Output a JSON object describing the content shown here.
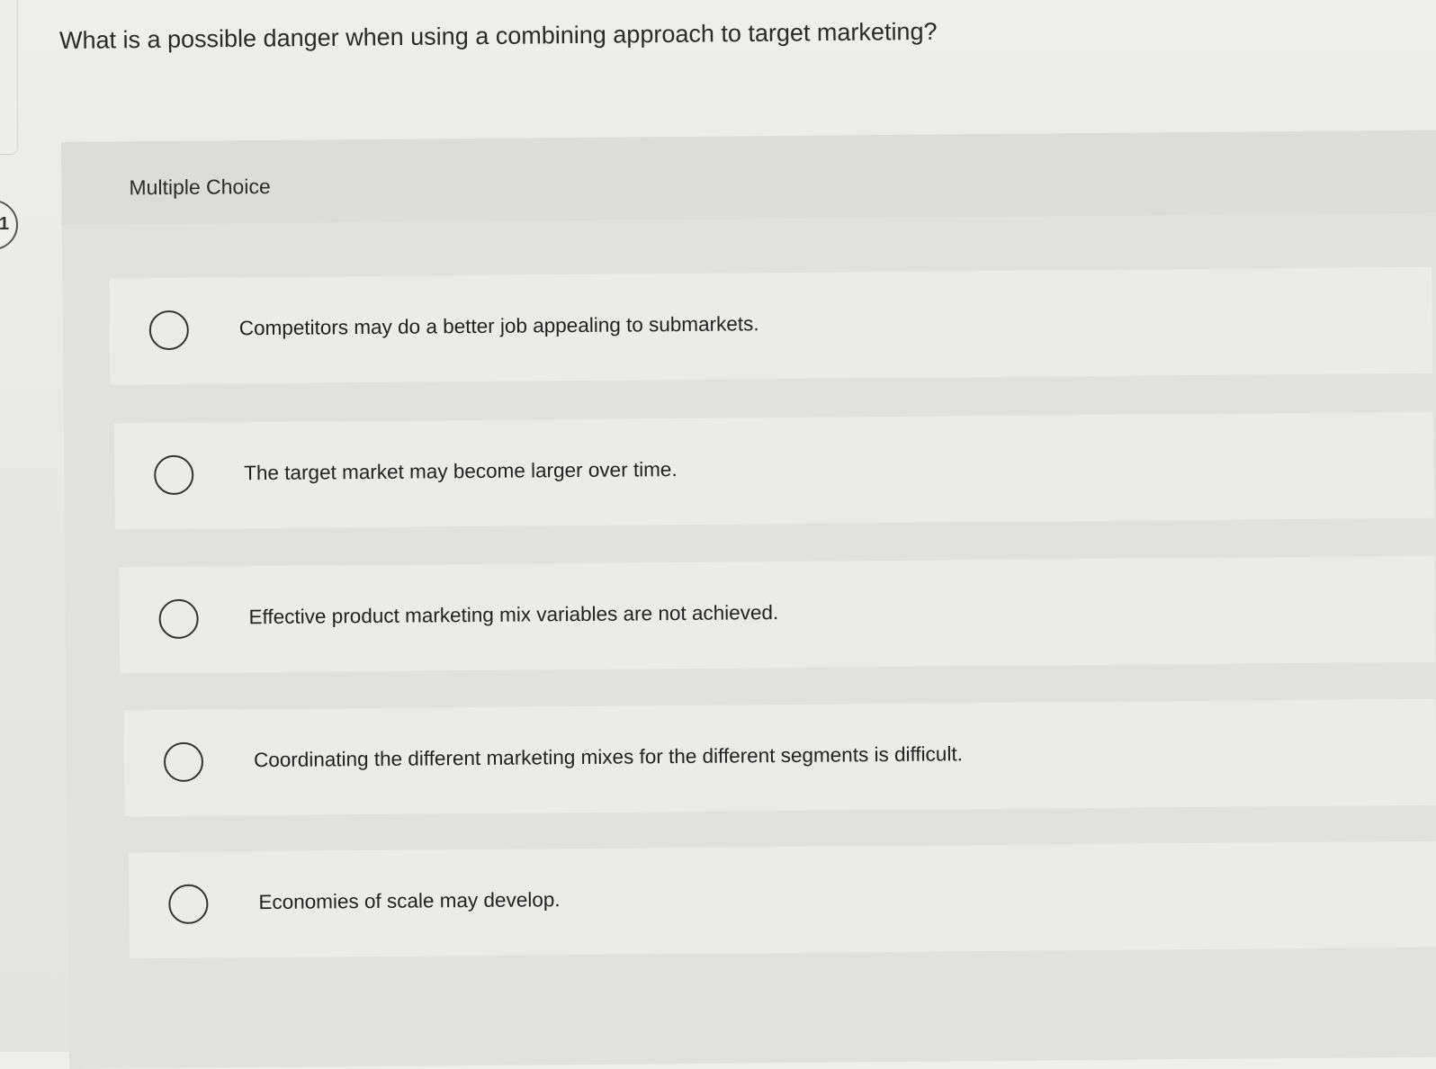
{
  "question": {
    "number": "1",
    "text": "What is a possible danger when using a combining approach to target marketing?"
  },
  "multiple_choice": {
    "label": "Multiple Choice",
    "options": [
      {
        "label": "Competitors may do a better job appealing to submarkets.",
        "selected": false
      },
      {
        "label": "The target market may become larger over time.",
        "selected": false
      },
      {
        "label": "Effective product marketing mix variables are not achieved.",
        "selected": false
      },
      {
        "label": "Coordinating the different marketing mixes for the different segments is difficult.",
        "selected": false
      },
      {
        "label": "Economies of scale may develop.",
        "selected": false
      }
    ]
  }
}
